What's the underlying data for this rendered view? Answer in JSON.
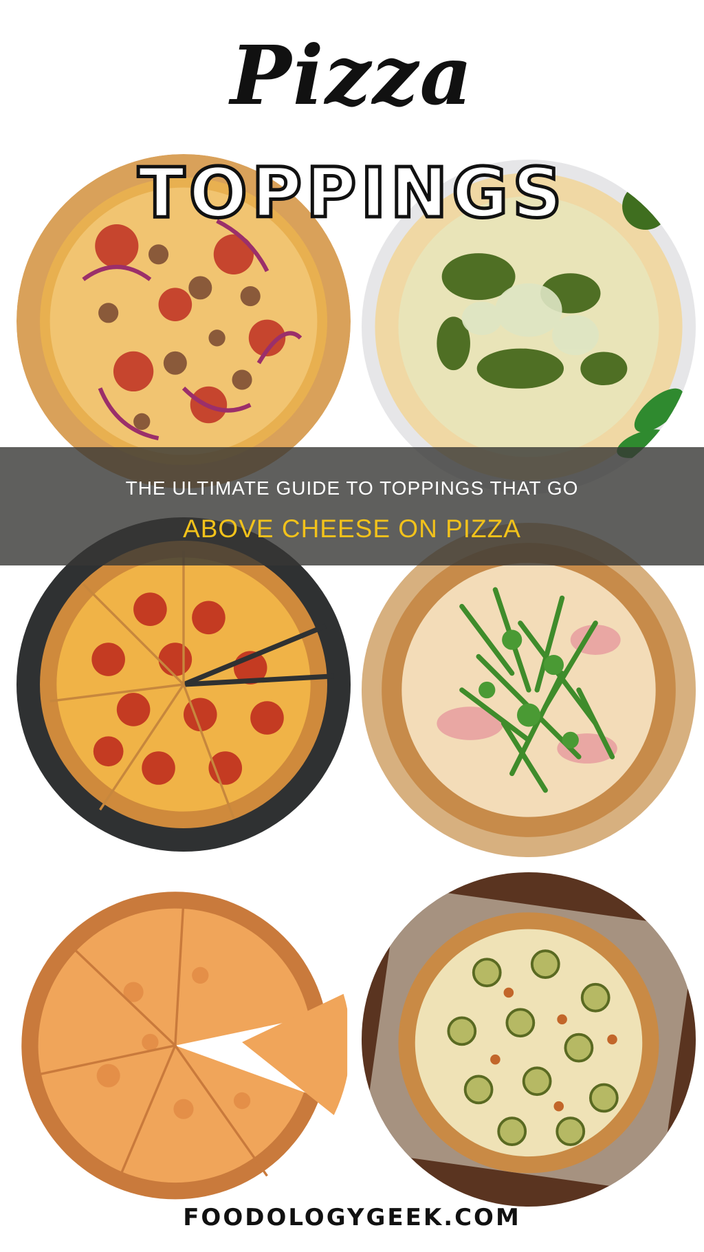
{
  "header": {
    "script_title": "Pizza",
    "outline_title": "TOPPINGS"
  },
  "banner": {
    "line1": "THE ULTIMATE GUIDE TO TOPPINGS THAT GO",
    "line2": "ABOVE CHEESE ON PIZZA",
    "line1_color": "#ffffff",
    "line2_color": "#f2c21b",
    "background": "#373734"
  },
  "footer": {
    "site": "FOODOLOGYGEEK.COM"
  }
}
